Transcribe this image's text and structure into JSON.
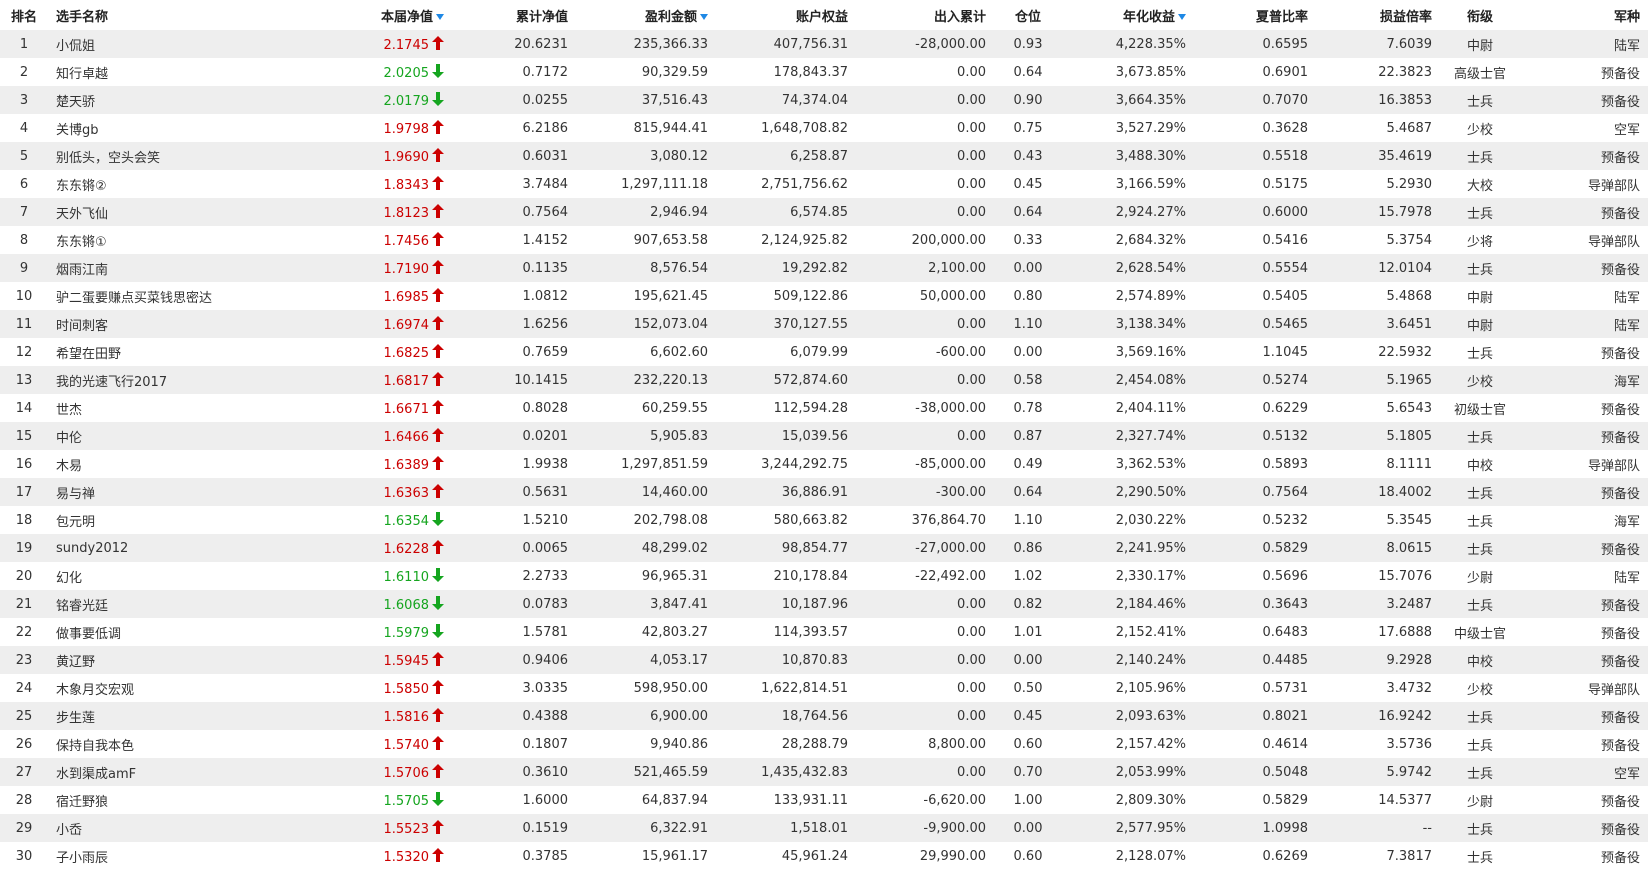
{
  "colors": {
    "up": "#cc0000",
    "down": "#15a51f",
    "sort_caret": "#1e88e5",
    "row_alt": "#eeeeee"
  },
  "icons": {
    "up": "arrow-up-icon",
    "down": "arrow-down-icon",
    "sort": "sort-desc-caret-icon"
  },
  "columns": [
    {
      "key": "rank",
      "label": "排名",
      "sortable": false
    },
    {
      "key": "name",
      "label": "选手名称",
      "sortable": false
    },
    {
      "key": "nav",
      "label": "本届净值",
      "sortable": true
    },
    {
      "key": "cum_nav",
      "label": "累计净值",
      "sortable": false
    },
    {
      "key": "profit",
      "label": "盈利金额",
      "sortable": true
    },
    {
      "key": "equity",
      "label": "账户权益",
      "sortable": false
    },
    {
      "key": "flow",
      "label": "出入累计",
      "sortable": false
    },
    {
      "key": "position",
      "label": "仓位",
      "sortable": false
    },
    {
      "key": "annual",
      "label": "年化收益",
      "sortable": true
    },
    {
      "key": "sharpe",
      "label": "夏普比率",
      "sortable": false
    },
    {
      "key": "pl_ratio",
      "label": "损益倍率",
      "sortable": false
    },
    {
      "key": "rank_title",
      "label": "衔级",
      "sortable": false
    },
    {
      "key": "branch",
      "label": "军种",
      "sortable": false
    }
  ],
  "rows": [
    {
      "rank": "1",
      "name": "小侃姐",
      "nav": "2.1745",
      "dir": "up",
      "cum_nav": "20.6231",
      "profit": "235,366.33",
      "equity": "407,756.31",
      "flow": "-28,000.00",
      "position": "0.93",
      "annual": "4,228.35%",
      "sharpe": "0.6595",
      "pl_ratio": "7.6039",
      "rank_title": "中尉",
      "branch": "陆军"
    },
    {
      "rank": "2",
      "name": "知行卓越",
      "nav": "2.0205",
      "dir": "down",
      "cum_nav": "0.7172",
      "profit": "90,329.59",
      "equity": "178,843.37",
      "flow": "0.00",
      "position": "0.64",
      "annual": "3,673.85%",
      "sharpe": "0.6901",
      "pl_ratio": "22.3823",
      "rank_title": "高级士官",
      "branch": "预备役"
    },
    {
      "rank": "3",
      "name": "楚天骄",
      "nav": "2.0179",
      "dir": "down",
      "cum_nav": "0.0255",
      "profit": "37,516.43",
      "equity": "74,374.04",
      "flow": "0.00",
      "position": "0.90",
      "annual": "3,664.35%",
      "sharpe": "0.7070",
      "pl_ratio": "16.3853",
      "rank_title": "士兵",
      "branch": "预备役"
    },
    {
      "rank": "4",
      "name": "关博gb",
      "nav": "1.9798",
      "dir": "up",
      "cum_nav": "6.2186",
      "profit": "815,944.41",
      "equity": "1,648,708.82",
      "flow": "0.00",
      "position": "0.75",
      "annual": "3,527.29%",
      "sharpe": "0.3628",
      "pl_ratio": "5.4687",
      "rank_title": "少校",
      "branch": "空军"
    },
    {
      "rank": "5",
      "name": "别低头，空头会笑",
      "nav": "1.9690",
      "dir": "up",
      "cum_nav": "0.6031",
      "profit": "3,080.12",
      "equity": "6,258.87",
      "flow": "0.00",
      "position": "0.43",
      "annual": "3,488.30%",
      "sharpe": "0.5518",
      "pl_ratio": "35.4619",
      "rank_title": "士兵",
      "branch": "预备役"
    },
    {
      "rank": "6",
      "name": "东东锵②",
      "nav": "1.8343",
      "dir": "up",
      "cum_nav": "3.7484",
      "profit": "1,297,111.18",
      "equity": "2,751,756.62",
      "flow": "0.00",
      "position": "0.45",
      "annual": "3,166.59%",
      "sharpe": "0.5175",
      "pl_ratio": "5.2930",
      "rank_title": "大校",
      "branch": "导弹部队"
    },
    {
      "rank": "7",
      "name": "天外飞仙",
      "nav": "1.8123",
      "dir": "up",
      "cum_nav": "0.7564",
      "profit": "2,946.94",
      "equity": "6,574.85",
      "flow": "0.00",
      "position": "0.64",
      "annual": "2,924.27%",
      "sharpe": "0.6000",
      "pl_ratio": "15.7978",
      "rank_title": "士兵",
      "branch": "预备役"
    },
    {
      "rank": "8",
      "name": "东东锵①",
      "nav": "1.7456",
      "dir": "up",
      "cum_nav": "1.4152",
      "profit": "907,653.58",
      "equity": "2,124,925.82",
      "flow": "200,000.00",
      "position": "0.33",
      "annual": "2,684.32%",
      "sharpe": "0.5416",
      "pl_ratio": "5.3754",
      "rank_title": "少将",
      "branch": "导弹部队"
    },
    {
      "rank": "9",
      "name": "烟雨江南",
      "nav": "1.7190",
      "dir": "up",
      "cum_nav": "0.1135",
      "profit": "8,576.54",
      "equity": "19,292.82",
      "flow": "2,100.00",
      "position": "0.00",
      "annual": "2,628.54%",
      "sharpe": "0.5554",
      "pl_ratio": "12.0104",
      "rank_title": "士兵",
      "branch": "预备役"
    },
    {
      "rank": "10",
      "name": "驴二蛋要赚点买菜钱思密达",
      "nav": "1.6985",
      "dir": "up",
      "cum_nav": "1.0812",
      "profit": "195,621.45",
      "equity": "509,122.86",
      "flow": "50,000.00",
      "position": "0.80",
      "annual": "2,574.89%",
      "sharpe": "0.5405",
      "pl_ratio": "5.4868",
      "rank_title": "中尉",
      "branch": "陆军"
    },
    {
      "rank": "11",
      "name": "时间刺客",
      "nav": "1.6974",
      "dir": "up",
      "cum_nav": "1.6256",
      "profit": "152,073.04",
      "equity": "370,127.55",
      "flow": "0.00",
      "position": "1.10",
      "annual": "3,138.34%",
      "sharpe": "0.5465",
      "pl_ratio": "3.6451",
      "rank_title": "中尉",
      "branch": "陆军"
    },
    {
      "rank": "12",
      "name": "希望在田野",
      "nav": "1.6825",
      "dir": "up",
      "cum_nav": "0.7659",
      "profit": "6,602.60",
      "equity": "6,079.99",
      "flow": "-600.00",
      "position": "0.00",
      "annual": "3,569.16%",
      "sharpe": "1.1045",
      "pl_ratio": "22.5932",
      "rank_title": "士兵",
      "branch": "预备役"
    },
    {
      "rank": "13",
      "name": "我的光速飞行2017",
      "nav": "1.6817",
      "dir": "up",
      "cum_nav": "10.1415",
      "profit": "232,220.13",
      "equity": "572,874.60",
      "flow": "0.00",
      "position": "0.58",
      "annual": "2,454.08%",
      "sharpe": "0.5274",
      "pl_ratio": "5.1965",
      "rank_title": "少校",
      "branch": "海军"
    },
    {
      "rank": "14",
      "name": "世杰",
      "nav": "1.6671",
      "dir": "up",
      "cum_nav": "0.8028",
      "profit": "60,259.55",
      "equity": "112,594.28",
      "flow": "-38,000.00",
      "position": "0.78",
      "annual": "2,404.11%",
      "sharpe": "0.6229",
      "pl_ratio": "5.6543",
      "rank_title": "初级士官",
      "branch": "预备役"
    },
    {
      "rank": "15",
      "name": "中伦",
      "nav": "1.6466",
      "dir": "up",
      "cum_nav": "0.0201",
      "profit": "5,905.83",
      "equity": "15,039.56",
      "flow": "0.00",
      "position": "0.87",
      "annual": "2,327.74%",
      "sharpe": "0.5132",
      "pl_ratio": "5.1805",
      "rank_title": "士兵",
      "branch": "预备役"
    },
    {
      "rank": "16",
      "name": "木易",
      "nav": "1.6389",
      "dir": "up",
      "cum_nav": "1.9938",
      "profit": "1,297,851.59",
      "equity": "3,244,292.75",
      "flow": "-85,000.00",
      "position": "0.49",
      "annual": "3,362.53%",
      "sharpe": "0.5893",
      "pl_ratio": "8.1111",
      "rank_title": "中校",
      "branch": "导弹部队"
    },
    {
      "rank": "17",
      "name": "易与禅",
      "nav": "1.6363",
      "dir": "up",
      "cum_nav": "0.5631",
      "profit": "14,460.00",
      "equity": "36,886.91",
      "flow": "-300.00",
      "position": "0.64",
      "annual": "2,290.50%",
      "sharpe": "0.7564",
      "pl_ratio": "18.4002",
      "rank_title": "士兵",
      "branch": "预备役"
    },
    {
      "rank": "18",
      "name": "包元明",
      "nav": "1.6354",
      "dir": "down",
      "cum_nav": "1.5210",
      "profit": "202,798.08",
      "equity": "580,663.82",
      "flow": "376,864.70",
      "position": "1.10",
      "annual": "2,030.22%",
      "sharpe": "0.5232",
      "pl_ratio": "5.3545",
      "rank_title": "士兵",
      "branch": "海军"
    },
    {
      "rank": "19",
      "name": "sundy2012",
      "nav": "1.6228",
      "dir": "up",
      "cum_nav": "0.0065",
      "profit": "48,299.02",
      "equity": "98,854.77",
      "flow": "-27,000.00",
      "position": "0.86",
      "annual": "2,241.95%",
      "sharpe": "0.5829",
      "pl_ratio": "8.0615",
      "rank_title": "士兵",
      "branch": "预备役"
    },
    {
      "rank": "20",
      "name": "幻化",
      "nav": "1.6110",
      "dir": "down",
      "cum_nav": "2.2733",
      "profit": "96,965.31",
      "equity": "210,178.84",
      "flow": "-22,492.00",
      "position": "1.02",
      "annual": "2,330.17%",
      "sharpe": "0.5696",
      "pl_ratio": "15.7076",
      "rank_title": "少尉",
      "branch": "陆军"
    },
    {
      "rank": "21",
      "name": "铭睿光廷",
      "nav": "1.6068",
      "dir": "down",
      "cum_nav": "0.0783",
      "profit": "3,847.41",
      "equity": "10,187.96",
      "flow": "0.00",
      "position": "0.82",
      "annual": "2,184.46%",
      "sharpe": "0.3643",
      "pl_ratio": "3.2487",
      "rank_title": "士兵",
      "branch": "预备役"
    },
    {
      "rank": "22",
      "name": "做事要低调",
      "nav": "1.5979",
      "dir": "down",
      "cum_nav": "1.5781",
      "profit": "42,803.27",
      "equity": "114,393.57",
      "flow": "0.00",
      "position": "1.01",
      "annual": "2,152.41%",
      "sharpe": "0.6483",
      "pl_ratio": "17.6888",
      "rank_title": "中级士官",
      "branch": "预备役"
    },
    {
      "rank": "23",
      "name": "黄辽野",
      "nav": "1.5945",
      "dir": "up",
      "cum_nav": "0.9406",
      "profit": "4,053.17",
      "equity": "10,870.83",
      "flow": "0.00",
      "position": "0.00",
      "annual": "2,140.24%",
      "sharpe": "0.4485",
      "pl_ratio": "9.2928",
      "rank_title": "中校",
      "branch": "预备役"
    },
    {
      "rank": "24",
      "name": "木象月交宏观",
      "nav": "1.5850",
      "dir": "up",
      "cum_nav": "3.0335",
      "profit": "598,950.00",
      "equity": "1,622,814.51",
      "flow": "0.00",
      "position": "0.50",
      "annual": "2,105.96%",
      "sharpe": "0.5731",
      "pl_ratio": "3.4732",
      "rank_title": "少校",
      "branch": "导弹部队"
    },
    {
      "rank": "25",
      "name": "步生莲",
      "nav": "1.5816",
      "dir": "up",
      "cum_nav": "0.4388",
      "profit": "6,900.00",
      "equity": "18,764.56",
      "flow": "0.00",
      "position": "0.45",
      "annual": "2,093.63%",
      "sharpe": "0.8021",
      "pl_ratio": "16.9242",
      "rank_title": "士兵",
      "branch": "预备役"
    },
    {
      "rank": "26",
      "name": "保持自我本色",
      "nav": "1.5740",
      "dir": "up",
      "cum_nav": "0.1807",
      "profit": "9,940.86",
      "equity": "28,288.79",
      "flow": "8,800.00",
      "position": "0.60",
      "annual": "2,157.42%",
      "sharpe": "0.4614",
      "pl_ratio": "3.5736",
      "rank_title": "士兵",
      "branch": "预备役"
    },
    {
      "rank": "27",
      "name": "水到渠成amF",
      "nav": "1.5706",
      "dir": "up",
      "cum_nav": "0.3610",
      "profit": "521,465.59",
      "equity": "1,435,432.83",
      "flow": "0.00",
      "position": "0.70",
      "annual": "2,053.99%",
      "sharpe": "0.5048",
      "pl_ratio": "5.9742",
      "rank_title": "士兵",
      "branch": "空军"
    },
    {
      "rank": "28",
      "name": "宿迁野狼",
      "nav": "1.5705",
      "dir": "down",
      "cum_nav": "1.6000",
      "profit": "64,837.94",
      "equity": "133,931.11",
      "flow": "-6,620.00",
      "position": "1.00",
      "annual": "2,809.30%",
      "sharpe": "0.5829",
      "pl_ratio": "14.5377",
      "rank_title": "少尉",
      "branch": "预备役"
    },
    {
      "rank": "29",
      "name": "小岙",
      "nav": "1.5523",
      "dir": "up",
      "cum_nav": "0.1519",
      "profit": "6,322.91",
      "equity": "1,518.01",
      "flow": "-9,900.00",
      "position": "0.00",
      "annual": "2,577.95%",
      "sharpe": "1.0998",
      "pl_ratio": "--",
      "rank_title": "士兵",
      "branch": "预备役"
    },
    {
      "rank": "30",
      "name": "子小雨辰",
      "nav": "1.5320",
      "dir": "up",
      "cum_nav": "0.3785",
      "profit": "15,961.17",
      "equity": "45,961.24",
      "flow": "29,990.00",
      "position": "0.60",
      "annual": "2,128.07%",
      "sharpe": "0.6269",
      "pl_ratio": "7.3817",
      "rank_title": "士兵",
      "branch": "预备役"
    }
  ]
}
